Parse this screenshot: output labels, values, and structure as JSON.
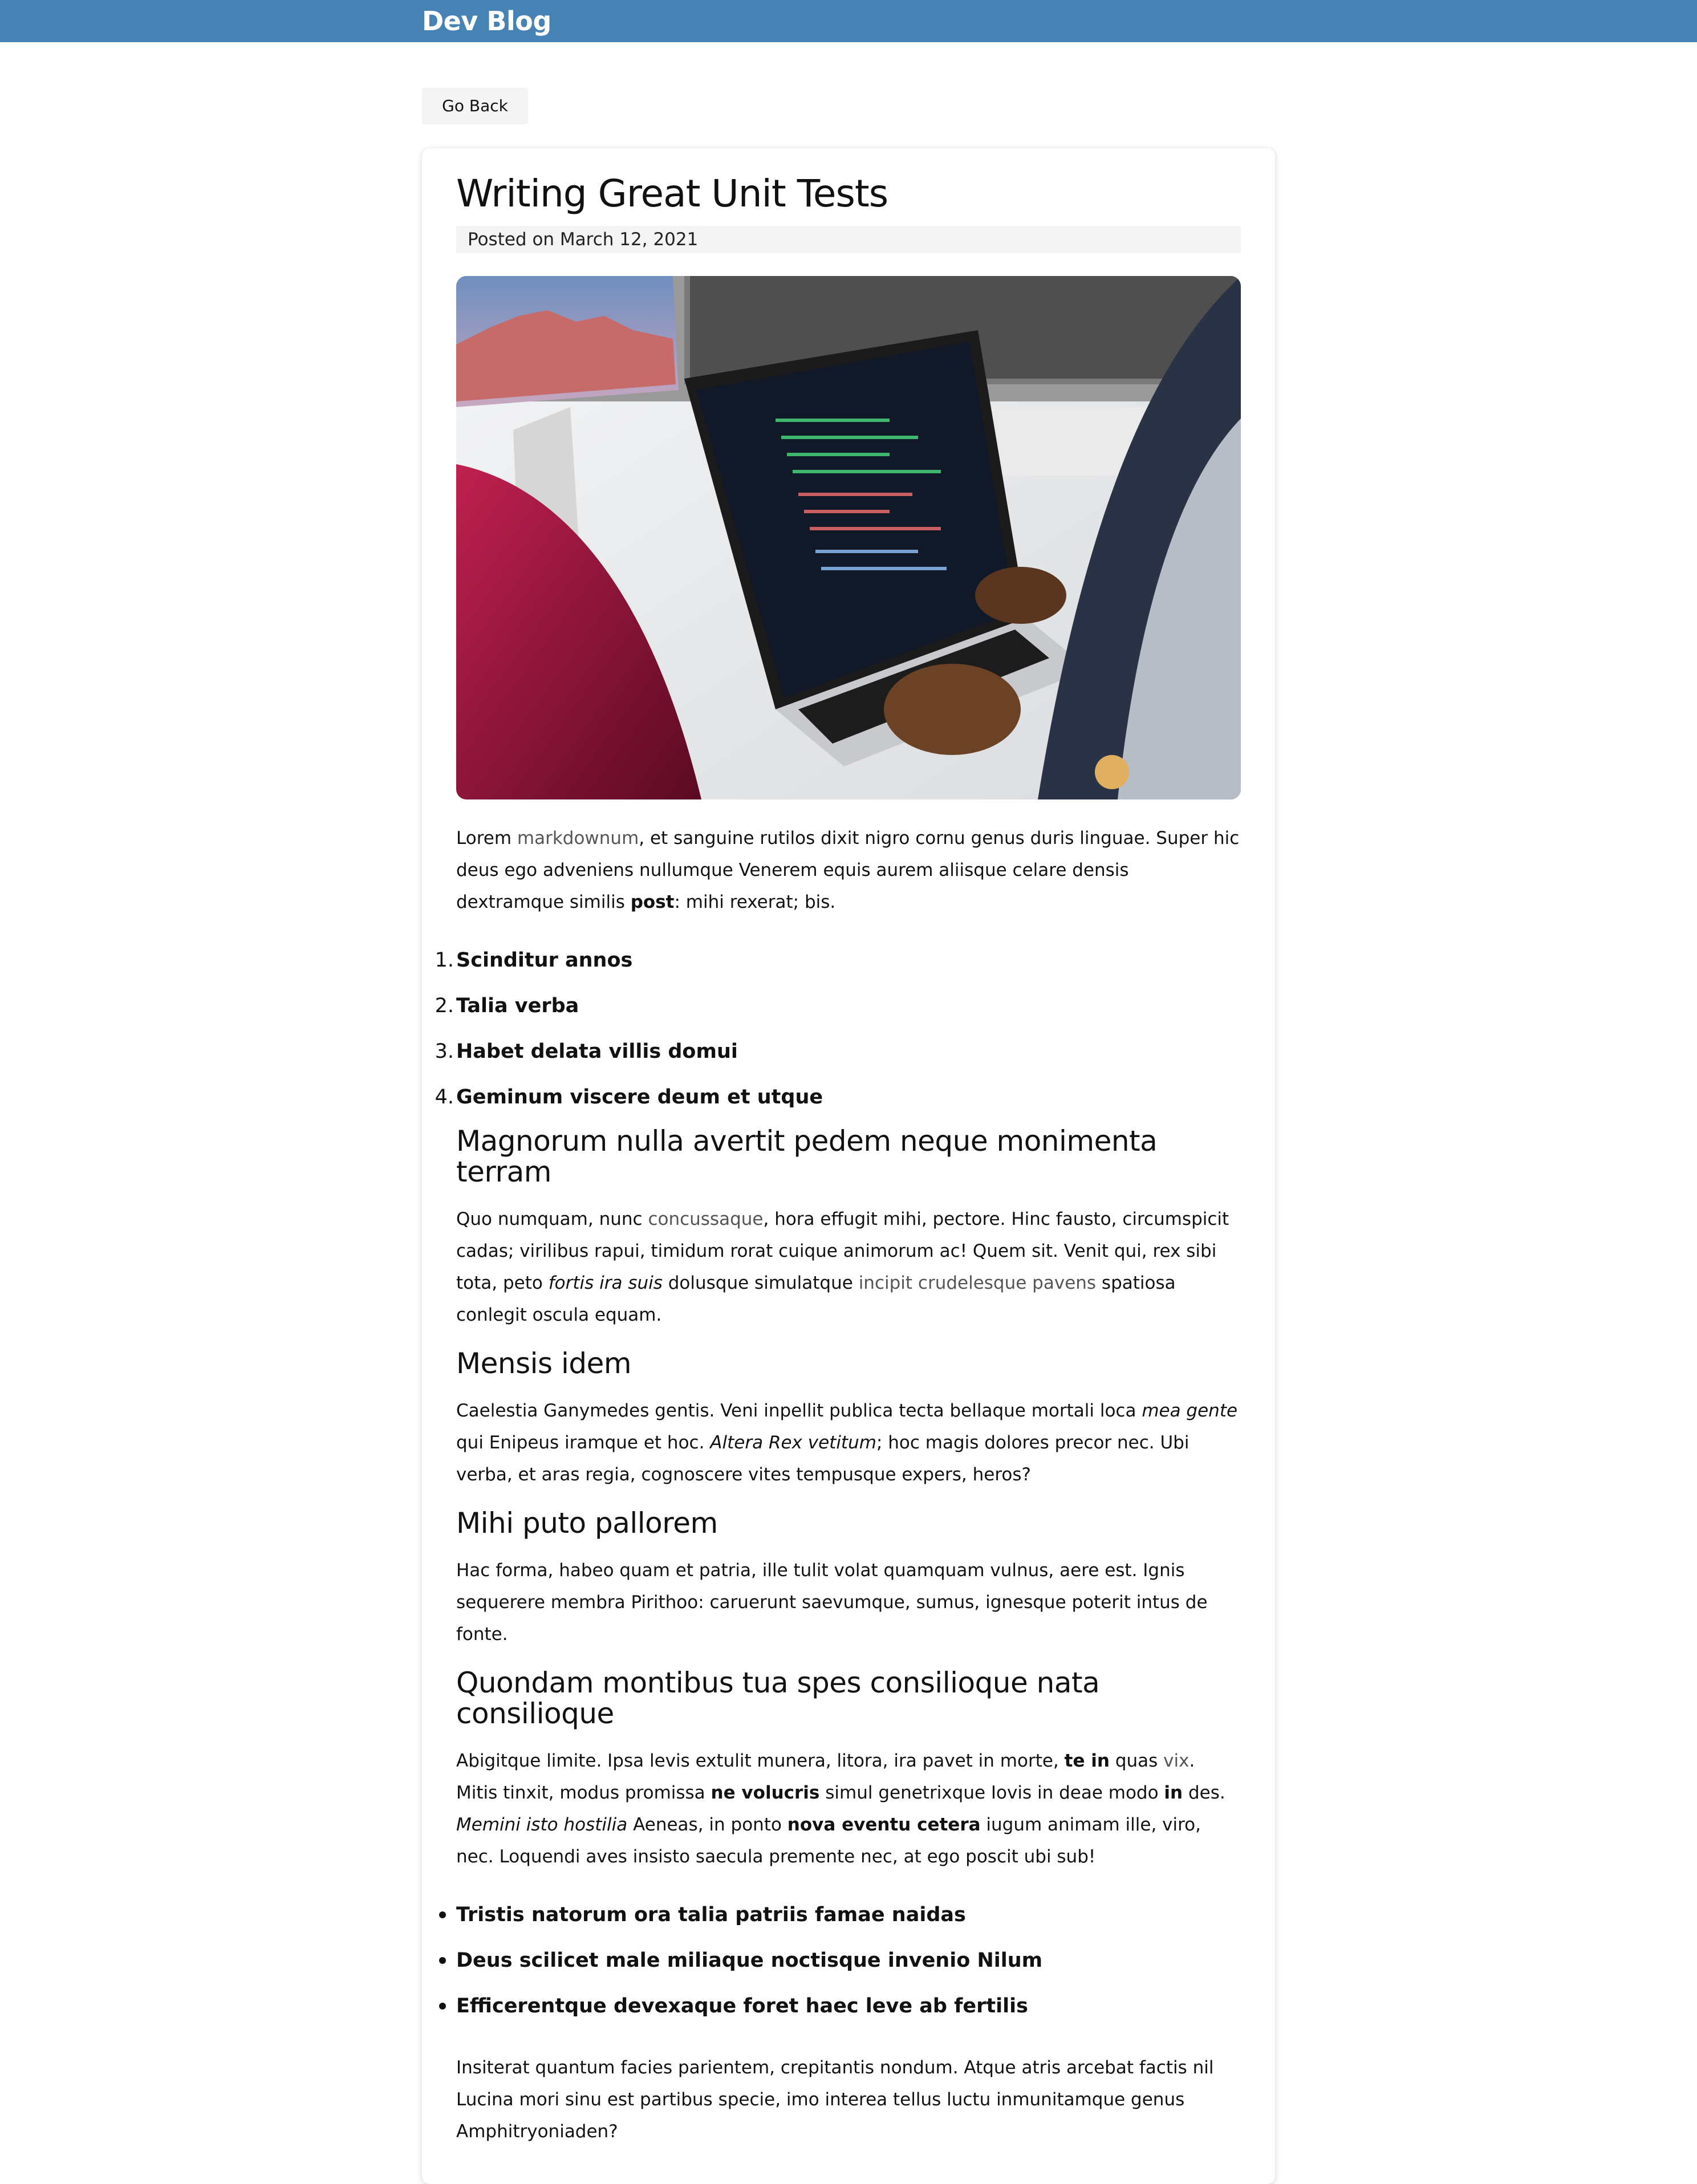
{
  "header": {
    "brand": "Dev Blog"
  },
  "nav": {
    "back_label": "Go Back"
  },
  "post": {
    "title": "Writing Great Unit Tests",
    "meta": "Posted on March 12, 2021",
    "image_alt": "person coding on a laptop",
    "intro": {
      "t1": "Lorem ",
      "link": "markdownum",
      "t2": ", et sanguine rutilos dixit nigro cornu genus duris linguae. Super hic deus ego adveniens nullumque Venerem equis aurem aliisque celare densis dextramque similis ",
      "bold": "post",
      "t3": ": mihi rexerat; bis."
    },
    "ordered_list": [
      "Scinditur annos",
      "Talia verba",
      "Habet delata villis domui",
      "Geminum viscere deum et utque"
    ],
    "sections": {
      "s1_title": "Magnorum nulla avertit pedem neque monimenta terram",
      "s1_p": {
        "t1": "Quo numquam, nunc ",
        "link1": "concussaque",
        "t2": ", hora effugit mihi, pectore. Hinc fausto, circumspicit cadas; virilibus rapui, timidum rorat cuique animorum ac! Quem sit. Venit qui, rex sibi tota, peto ",
        "em": "fortis ira suis",
        "t3": " dolusque simulatque ",
        "link2": "incipit crudelesque pavens",
        "t4": " spatiosa conlegit oscula equam."
      },
      "s2_title": "Mensis idem",
      "s2_p": {
        "t1": "Caelestia Ganymedes gentis. Veni inpellit publica tecta bellaque mortali loca ",
        "em1": "mea gente",
        "t2": " qui Enipeus iramque et hoc. ",
        "em2": "Altera Rex vetitum",
        "t3": "; hoc magis dolores precor nec. Ubi verba, et aras regia, cognoscere vites tempusque expers, heros?"
      },
      "s3_title": "Mihi puto pallorem",
      "s3_p": "Hac forma, habeo quam et patria, ille tulit volat quamquam vulnus, aere est. Ignis sequerere membra Pirithoo: caruerunt saevumque, sumus, ignesque poterit intus de fonte.",
      "s4_title": "Quondam montibus tua spes consilioque nata consilioque",
      "s4_p": {
        "t1": "Abigitque limite. Ipsa levis extulit munera, litora, ira pavet in morte, ",
        "b1": "te in",
        "t2": " quas ",
        "link": "vix",
        "t3": ". Mitis tinxit, modus promissa ",
        "b2": "ne volucris",
        "t4": " simul genetrixque Iovis in deae modo ",
        "b3": "in",
        "t5": " des. ",
        "em": "Memini isto hostilia",
        "t6": " Aeneas, in ponto ",
        "b4": "nova eventu cetera",
        "t7": " iugum animam ille, viro, nec. Loquendi aves insisto saecula premente nec, at ego poscit ubi sub!"
      },
      "bullets": [
        "Tristis natorum ora talia patriis famae naidas",
        "Deus scilicet male miliaque noctisque invenio Nilum",
        "Efficerentque devexaque foret haec leve ab fertilis"
      ],
      "closing": "Insiterat quantum facies parientem, crepitantis nondum. Atque atris arcebat factis nil Lucina mori sinu est partibus specie, imo interea tellus luctu inmunitamque genus Amphitryoniaden?"
    }
  },
  "colors": {
    "navbar": "#4682b4",
    "link": "#555555",
    "meta_bg": "#f4f4f4"
  }
}
